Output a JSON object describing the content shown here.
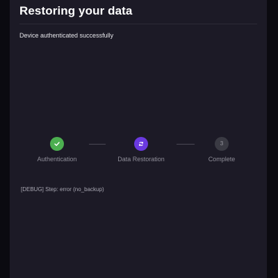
{
  "header": {
    "title": "Restoring your data",
    "status_message": "Device authenticated successfully"
  },
  "stepper": {
    "steps": [
      {
        "label": "Authentication",
        "state": "completed",
        "icon": "check-icon",
        "color": "#4caf50"
      },
      {
        "label": "Data Restoration",
        "state": "in-progress",
        "icon": "sync-icon",
        "color": "#6a39e0"
      },
      {
        "label": "Complete",
        "state": "pending",
        "number": "3",
        "color": "#3a3a43"
      }
    ]
  },
  "debug": {
    "text": "[DEBUG] Step: error (no_backup)"
  },
  "colors": {
    "background": "#0b0a10",
    "panel": "#1c1a26",
    "text": "#ffffff",
    "muted": "#8f8e99"
  }
}
